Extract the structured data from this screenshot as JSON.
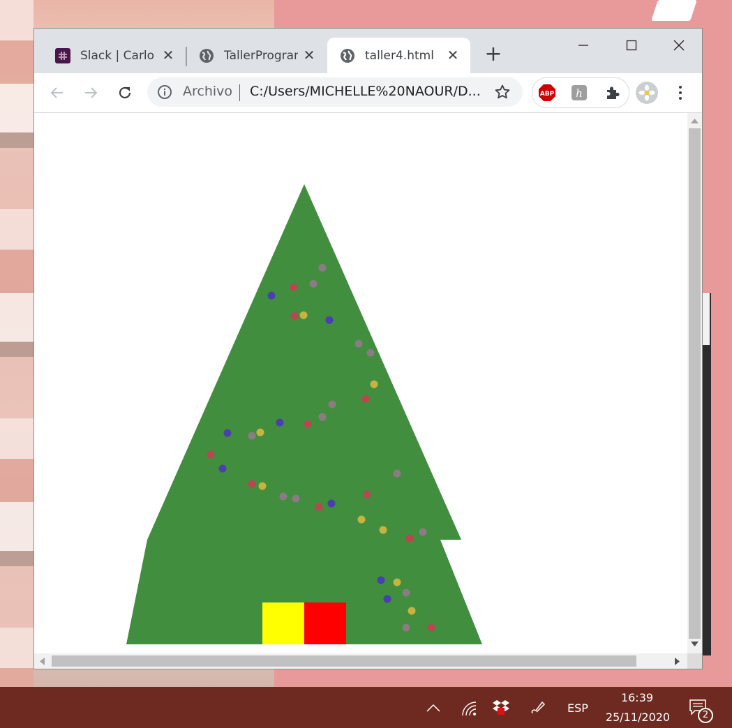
{
  "tabs": [
    {
      "title": "Slack | Carlos",
      "icon": "slack-icon",
      "active": false
    },
    {
      "title": "TallerProgram",
      "icon": "globe-icon",
      "active": false
    },
    {
      "title": "taller4.html",
      "icon": "globe-icon",
      "active": true
    }
  ],
  "omnibox": {
    "scheme_label": "Archivo",
    "url": "C:/Users/MICHELLE%20NAOUR/D..."
  },
  "extensions": [
    "adblock-plus-icon",
    "pushbullet-icon",
    "extensions-puzzle-icon"
  ],
  "page": {
    "tree_color": "#418e3f",
    "gifts": [
      {
        "color": "#ffff00"
      },
      {
        "color": "#ff0000"
      }
    ],
    "light_colors": {
      "red": "#b9474f",
      "blue": "#4a3fb0",
      "yellow": "#c7b340",
      "gray": "#8c7a85"
    }
  },
  "taskbar": {
    "language": "ESP",
    "time": "16:39",
    "date": "25/11/2020",
    "notification_count": "2"
  }
}
